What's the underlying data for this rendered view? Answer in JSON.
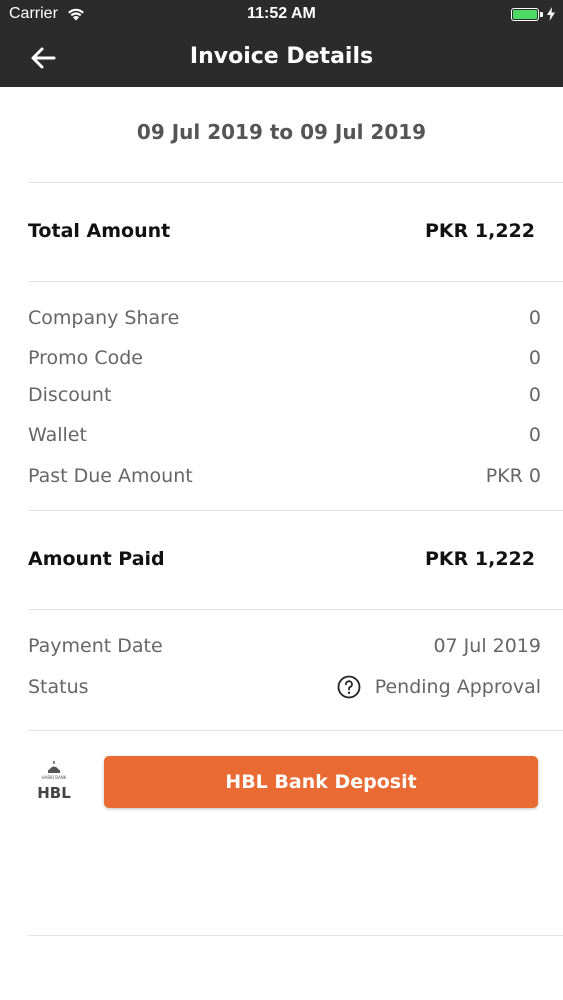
{
  "status_bar": {
    "carrier": "Carrier",
    "time": "11:52 AM",
    "battery_color": "#4cd964"
  },
  "nav": {
    "title": "Invoice Details",
    "back_icon": "arrow-left-icon",
    "background_color": "#2b2b2b"
  },
  "invoice": {
    "date_range": "09 Jul 2019 to 09 Jul 2019",
    "total": {
      "label": "Total Amount",
      "value": "PKR 1,222"
    },
    "breakdown": [
      {
        "label": "Company Share",
        "value": "0"
      },
      {
        "label": "Promo Code",
        "value": "0"
      },
      {
        "label": "Discount",
        "value": "0"
      },
      {
        "label": "Wallet",
        "value": "0"
      },
      {
        "label": "Past Due Amount",
        "value": "PKR 0"
      }
    ],
    "paid": {
      "label": "Amount Paid",
      "value": "PKR 1,222"
    },
    "payment_date": {
      "label": "Payment Date",
      "value": "07 Jul 2019"
    },
    "status": {
      "label": "Status",
      "value": "Pending Approval",
      "icon": "question-circle-icon"
    }
  },
  "payment": {
    "bank_logo_text": "HBL",
    "bank_logo_subtext": "HABIB BANK",
    "button_label": "HBL Bank Deposit",
    "button_color": "#ea6a33"
  }
}
